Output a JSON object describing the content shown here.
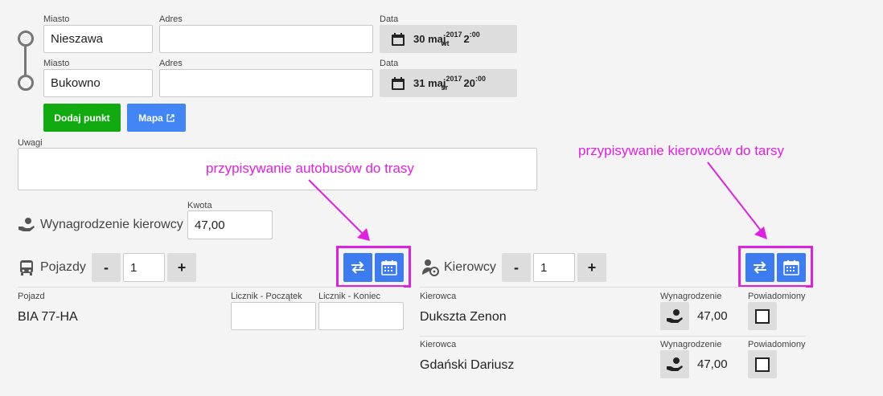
{
  "route": {
    "points": [
      {
        "city_label": "Miasto",
        "city": "Nieszawa",
        "address_label": "Adres",
        "address": "",
        "date_label": "Data",
        "date_day": "30 maj",
        "date_year": "2017",
        "date_weekday": "wt",
        "time_hour": "2",
        "time_min": ":00"
      },
      {
        "city_label": "Miasto",
        "city": "Bukowno",
        "address_label": "Adres",
        "address": "",
        "date_label": "Data",
        "date_day": "31 maj",
        "date_year": "2017",
        "date_weekday": "śr",
        "time_hour": "20",
        "time_min": ":00"
      }
    ],
    "add_point_label": "Dodaj punkt",
    "map_label": "Mapa"
  },
  "notes": {
    "label": "Uwagi",
    "value": ""
  },
  "driver_pay": {
    "title": "Wynagrodzenie kierowcy",
    "amount_label": "Kwota",
    "amount": "47,00"
  },
  "vehicles": {
    "title": "Pojazdy",
    "minus": "-",
    "plus": "+",
    "count": "1",
    "col_vehicle": "Pojazd",
    "col_start": "Licznik - Początek",
    "col_end": "Licznik - Koniec",
    "rows": [
      {
        "vehicle": "BIA 77-HA",
        "start": "",
        "end": ""
      }
    ]
  },
  "drivers": {
    "title": "Kierowcy",
    "minus": "-",
    "plus": "+",
    "count": "1",
    "rows": [
      {
        "driver_label": "Kierowca",
        "driver": "Dukszta Zenon",
        "pay_label": "Wynagrodzenie",
        "pay": "47,00",
        "notified_label": "Powiadomiony",
        "notified": false
      },
      {
        "driver_label": "Kierowca",
        "driver": "Gdański Dariusz",
        "pay_label": "Wynagrodzenie",
        "pay": "47,00",
        "notified_label": "Powiadomiony",
        "notified": false
      }
    ]
  },
  "annotations": {
    "buses": "przypisywanie autobusów do trasy",
    "drivers": "przypisywanie kierowców do tarsy",
    "color": "#e020e0"
  },
  "colors": {
    "green": "#11aa11",
    "blue": "#4285f4",
    "icon_blue": "#3d7cf0"
  },
  "icons": [
    "calendar-icon",
    "external-link-icon",
    "money-hand-icon",
    "bus-icon",
    "driver-icon",
    "swap-icon",
    "calendar-grid-icon"
  ]
}
